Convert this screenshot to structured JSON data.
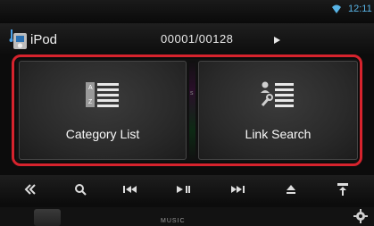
{
  "status": {
    "time": "12:11",
    "wifi_icon": "wifi-icon"
  },
  "header": {
    "source_label": "iPod",
    "source_icon": "ipod-music-icon",
    "track_counter": "00001/00128",
    "play_state_icon": "play-triangle-icon"
  },
  "main": {
    "category_list": {
      "label": "Category List",
      "icon": "alphabet-list-icon"
    },
    "link_search": {
      "label": "Link Search",
      "icon": "link-search-icon"
    },
    "highlight_color": "#d6232d"
  },
  "controls": {
    "items": [
      {
        "icon": "double-chevron-left-icon"
      },
      {
        "icon": "search-icon"
      },
      {
        "icon": "previous-track-icon"
      },
      {
        "icon": "play-pause-icon"
      },
      {
        "icon": "next-track-icon"
      },
      {
        "icon": "eject-icon"
      },
      {
        "icon": "tilt-icon"
      }
    ]
  },
  "bottom": {
    "mode_text": "MUSIC",
    "settings_icon": "gear-icon"
  },
  "colors": {
    "accent": "#58b4e6",
    "background": "#0c0c0c"
  }
}
